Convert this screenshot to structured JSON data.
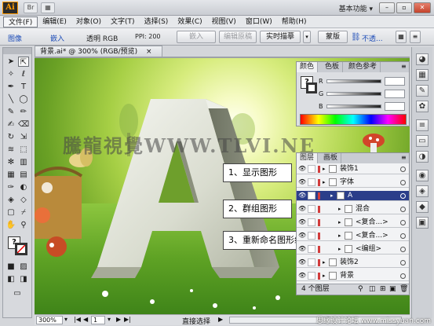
{
  "titlebar": {
    "app_logo": "Ai",
    "bridge_label": "Br",
    "workspace": "基本功能",
    "workspace_arrow": "▾",
    "minimize": "–",
    "restore": "▫",
    "close": "✕"
  },
  "menubar": {
    "items": [
      "文件(F)",
      "编辑(E)",
      "对象(O)",
      "文字(T)",
      "选择(S)",
      "效果(C)",
      "视图(V)",
      "窗口(W)",
      "帮助(H)"
    ]
  },
  "controlbar": {
    "image_label": "图像",
    "embed_label": "嵌入",
    "transparency": "透明 RGB",
    "ppi": "PPI: 200",
    "embed_btn": "嵌入",
    "edit_original_btn": "编辑原稿",
    "live_trace_btn": "实时描摹",
    "mask_btn": "蒙版",
    "opacity_label": "不透...",
    "link_icon": "⛓"
  },
  "document": {
    "tab_title": "背景.ai* @ 300% (RGB/预览)",
    "tab_close": "×",
    "watermark": "騰龍視覺WWW.TLVI.NE",
    "callouts": [
      "1、显示图形",
      "2、群组图形",
      "3、重新命名图形组"
    ]
  },
  "statusbar": {
    "zoom": "300%",
    "page": "1",
    "tool_name": "直接选择"
  },
  "color_panel": {
    "tabs": [
      "颜色",
      "色板",
      "颜色参考"
    ],
    "channels": [
      "R",
      "G",
      "B"
    ]
  },
  "layers_panel": {
    "tabs": [
      "图层",
      "画板"
    ],
    "rows": [
      {
        "name": "装饰1",
        "indent": 0,
        "highlight": false
      },
      {
        "name": "字体",
        "indent": 0,
        "highlight": false
      },
      {
        "name": "A",
        "indent": 1,
        "highlight": true
      },
      {
        "name": "混合",
        "indent": 2,
        "highlight": false
      },
      {
        "name": "<复合...>",
        "indent": 2,
        "highlight": false
      },
      {
        "name": "<复合...>",
        "indent": 2,
        "highlight": false
      },
      {
        "name": "<编组>",
        "indent": 2,
        "highlight": false
      },
      {
        "name": "装饰2",
        "indent": 0,
        "highlight": false
      },
      {
        "name": "背景",
        "indent": 0,
        "highlight": false
      }
    ],
    "layer_count": "4 个图层"
  },
  "footer_credit": "思缘设计论坛 www.missyuan.com"
}
